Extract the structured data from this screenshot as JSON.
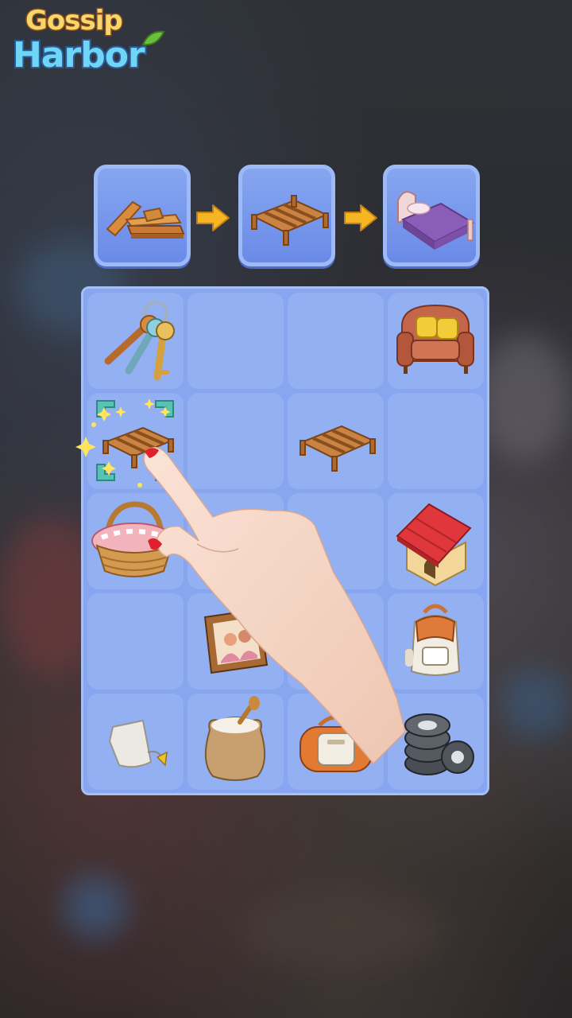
{
  "logo": {
    "line1": "Gossip",
    "line2": "Harbor"
  },
  "merge_chain": {
    "items": [
      {
        "name": "wooden-planks"
      },
      {
        "name": "bed-frame"
      },
      {
        "name": "purple-bed"
      }
    ]
  },
  "board": {
    "rows": [
      [
        "keys",
        "",
        "",
        "sofa"
      ],
      [
        "bed-frame-highlighted",
        "",
        "bed-frame",
        ""
      ],
      [
        "picnic-basket",
        "",
        "",
        "dog-house"
      ],
      [
        "",
        "photo-frame",
        "",
        "backpack"
      ],
      [
        "tea-bag",
        "flour-sack",
        "duffel-bag",
        "tire-stack"
      ]
    ]
  },
  "colors": {
    "board_bg": "#88a6ef",
    "cell_bg": "#93b0f3",
    "card_bg": "#7496ea",
    "arrow": "#f5b524"
  }
}
